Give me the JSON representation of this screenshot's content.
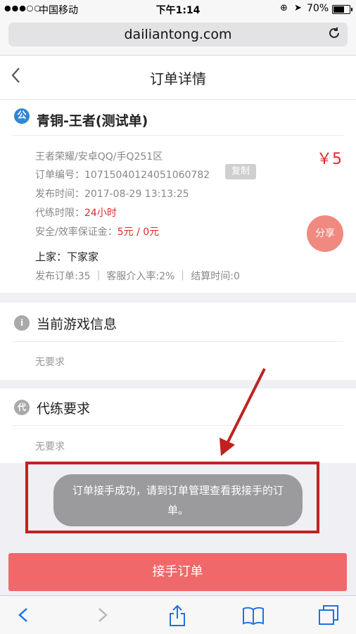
{
  "status": {
    "signal_dots": "●●●○○",
    "carrier": "中国移动",
    "time": "下午1:14",
    "battery": "70%",
    "battery_level": 0.7
  },
  "browser": {
    "url": "dailiantong.com"
  },
  "header": {
    "title": "订单详情"
  },
  "order": {
    "badge": "公",
    "title": "青铜-王者(测试单)",
    "game_info": "王者荣耀/安卓QQ/手Q251区",
    "price": "￥5",
    "order_no_label": "订单编号：",
    "order_no": "10715040124051060782",
    "copy_label": "复制",
    "publish_time_label": "发布时间：",
    "publish_time": "2017-08-29 13:13:25",
    "duration_label": "代练时限：",
    "duration": "24小时",
    "deposit_label": "安全/效率保证金：",
    "deposit": "5元 / 0元",
    "share_label": "分享",
    "boss_label": "上家：",
    "boss": "下家家",
    "stats": "发布订单:35  ｜  客服介入率:2%  ｜  结算时间:0"
  },
  "sections": {
    "game_info": {
      "icon": "i",
      "title": "当前游戏信息",
      "body": "无要求"
    },
    "requirements": {
      "icon": "代",
      "title": "代练要求",
      "body": "无要求"
    }
  },
  "toast": {
    "text": "订单接手成功，请到订单管理查看我接手的订单。"
  },
  "accept_button": {
    "label": "接手订单"
  },
  "colors": {
    "accent_red": "#f0686a",
    "price_red": "#e02828",
    "highlight_red": "#c0221e",
    "ios_blue": "#1a73e8"
  },
  "icons": {
    "back": "chevron-left-icon",
    "forward": "chevron-right-icon",
    "share": "share-icon",
    "bookmarks": "book-icon",
    "tabs": "tabs-icon",
    "reload": "reload-icon"
  }
}
